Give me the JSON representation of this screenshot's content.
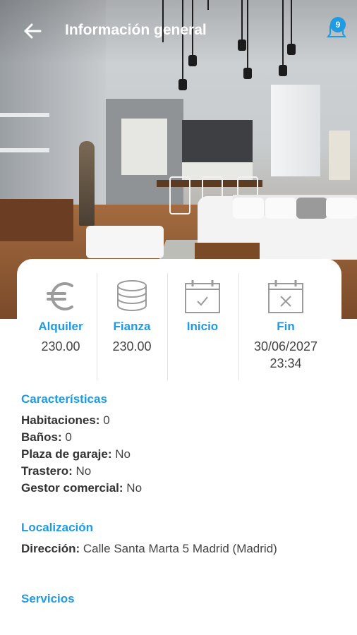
{
  "header": {
    "title": "Información general",
    "notification_count": "9",
    "back_icon": "arrow-left-icon",
    "notification_icon": "bell-icon"
  },
  "summary": [
    {
      "icon": "euro-icon",
      "label": "Alquiler",
      "value": "230.00",
      "value2": ""
    },
    {
      "icon": "coins-stack-icon",
      "label": "Fianza",
      "value": "230.00",
      "value2": ""
    },
    {
      "icon": "calendar-check-icon",
      "label": "Inicio",
      "value": "",
      "value2": ""
    },
    {
      "icon": "calendar-x-icon",
      "label": "Fin",
      "value": "30/06/2027",
      "value2": "23:34"
    }
  ],
  "caracteristicas": {
    "title": "Características",
    "items": [
      {
        "label": "Habitaciones:",
        "value": "0"
      },
      {
        "label": "Baños:",
        "value": "0"
      },
      {
        "label": "Plaza de garaje:",
        "value": "No"
      },
      {
        "label": "Trastero:",
        "value": "No"
      },
      {
        "label": "Gestor comercial:",
        "value": "No"
      }
    ]
  },
  "localizacion": {
    "title": "Localización",
    "label": "Dirección:",
    "value": "Calle Santa Marta 5 Madrid (Madrid)"
  },
  "servicios": {
    "title": "Servicios"
  },
  "colors": {
    "accent": "#1e9be3",
    "text": "#444444",
    "icon_gray": "#9b9b9b"
  }
}
